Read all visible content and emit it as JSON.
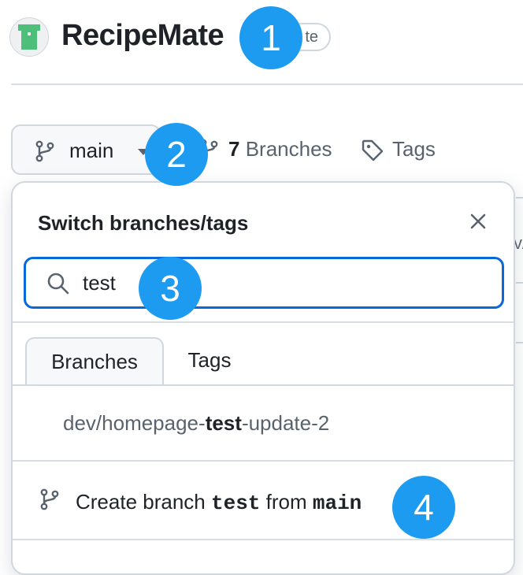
{
  "repo": {
    "name": "RecipeMate",
    "visibility_fragment": "te"
  },
  "branch_bar": {
    "current_branch": "main",
    "branch_count": "7",
    "branches_label": "Branches",
    "tags_label": "Tags"
  },
  "dropdown": {
    "title": "Switch branches/tags",
    "search_value": "test",
    "tabs": [
      {
        "label": "Branches",
        "active": true
      },
      {
        "label": "Tags",
        "active": false
      }
    ],
    "results": [
      {
        "prefix": "dev/homepage-",
        "match": "test",
        "suffix": "-update-2"
      }
    ],
    "create": {
      "prefix": "Create branch ",
      "name": "test",
      "middle": " from ",
      "source": "main"
    }
  },
  "edge_fragment": "v/",
  "markers": [
    "1",
    "2",
    "3",
    "4"
  ],
  "colors": {
    "accent_blue": "#0969da",
    "marker_blue": "#1d9bf0",
    "avatar_green": "#4ebf7a"
  }
}
